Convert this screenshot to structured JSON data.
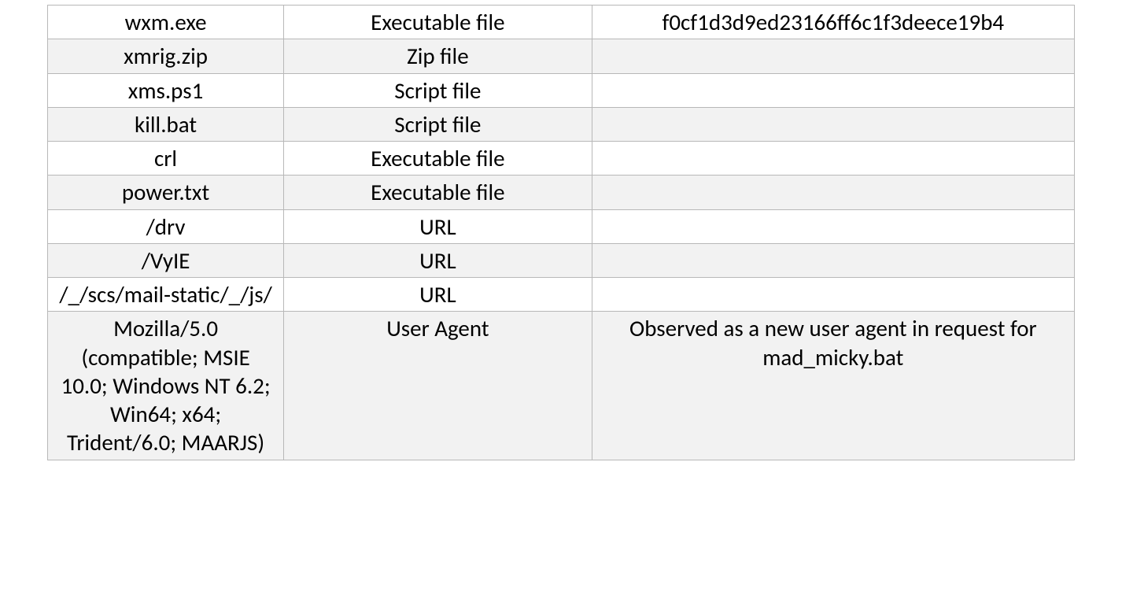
{
  "table": {
    "rows": [
      {
        "indicator": "wxm.exe",
        "type": "Executable file",
        "note": "f0cf1d3d9ed23166ff6c1f3deece19b4",
        "alt": false
      },
      {
        "indicator": "xmrig.zip",
        "type": "Zip file",
        "note": "",
        "alt": true
      },
      {
        "indicator": "xms.ps1",
        "type": "Script file",
        "note": "",
        "alt": false
      },
      {
        "indicator": "kill.bat",
        "type": "Script file",
        "note": "",
        "alt": true
      },
      {
        "indicator": "crl",
        "type": "Executable file",
        "note": "",
        "alt": false
      },
      {
        "indicator": "power.txt",
        "type": "Executable file",
        "note": "",
        "alt": true
      },
      {
        "indicator": "/drv",
        "type": "URL",
        "note": "",
        "alt": false
      },
      {
        "indicator": "/VyIE",
        "type": "URL",
        "note": "",
        "alt": true
      },
      {
        "indicator": "/_/scs/mail-static/_/js/",
        "type": "URL",
        "note": "",
        "alt": false
      },
      {
        "indicator": "Mozilla/5.0 (compatible; MSIE 10.0; Windows NT 6.2; Win64; x64; Trident/6.0; MAARJS)",
        "type": "User Agent",
        "note": "Observed as a new user agent in request for mad_micky.bat",
        "alt": true
      }
    ]
  }
}
